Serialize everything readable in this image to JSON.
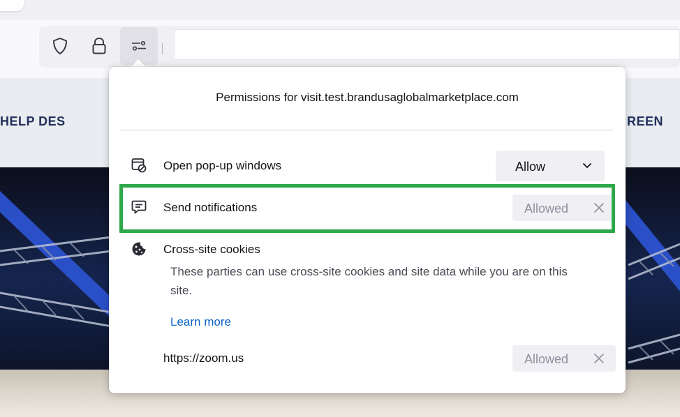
{
  "browser": {
    "toolbar_icons": [
      "shield-icon",
      "lock-icon",
      "permissions-icon"
    ],
    "url": ""
  },
  "page": {
    "nav_left": "HELP DES",
    "nav_right": "REEN"
  },
  "popup": {
    "title": "Permissions for visit.test.brandusaglobalmarketplace.com",
    "permissions": [
      {
        "icon": "popup-window-blocked-icon",
        "label": "Open pop-up windows",
        "control": "select",
        "value": "Allow"
      },
      {
        "icon": "notification-icon",
        "label": "Send notifications",
        "control": "badge",
        "value": "Allowed",
        "highlighted": true
      },
      {
        "icon": "cookie-icon",
        "label": "Cross-site cookies",
        "description": "These parties can use cross-site cookies and site data while you are on this site.",
        "learn_more": "Learn more",
        "site": {
          "name": "https://zoom.us",
          "value": "Allowed"
        }
      }
    ]
  },
  "colors": {
    "highlight": "#2ea84a",
    "link": "#0b63c8",
    "muted_text": "#8f8f9d"
  }
}
